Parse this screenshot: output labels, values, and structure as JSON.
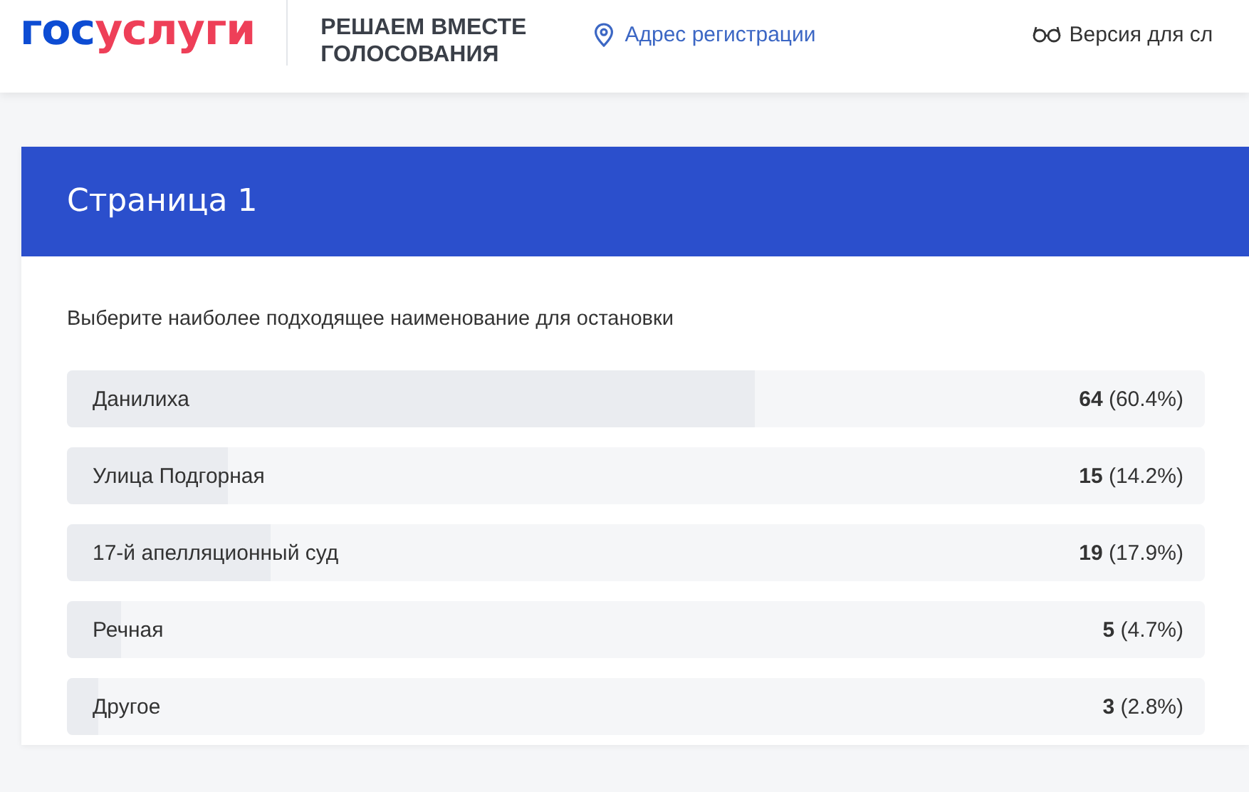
{
  "header": {
    "logo": [
      {
        "text": "гос",
        "color": "#0d4cd3"
      },
      {
        "text": "услуги",
        "color": "#ee3f58"
      }
    ],
    "project_title": [
      "РЕШАЕМ ВМЕСТЕ",
      "ГОЛОСОВАНИЯ"
    ],
    "address_link": "Адрес регистрации",
    "accessibility_link": "Версия для сл"
  },
  "page_title": "Страница 1",
  "question": "Выберите наиболее подходящее наименование для остановки",
  "options": [
    {
      "label": "Данилиха",
      "result": "**64** (60.4%)",
      "level": 0.604
    },
    {
      "label": "Улица Подгорная",
      "result": "**15** (14.2%)",
      "level": 0.142
    },
    {
      "label": "17-й апелляционный суд",
      "result": "**19** (17.9%)",
      "level": 0.179
    },
    {
      "label": "Речная",
      "result": "**5** (4.7%)",
      "level": 0.047
    },
    {
      "label": "Другое",
      "result": "**3** (2.8%)",
      "level": 0.028
    }
  ]
}
